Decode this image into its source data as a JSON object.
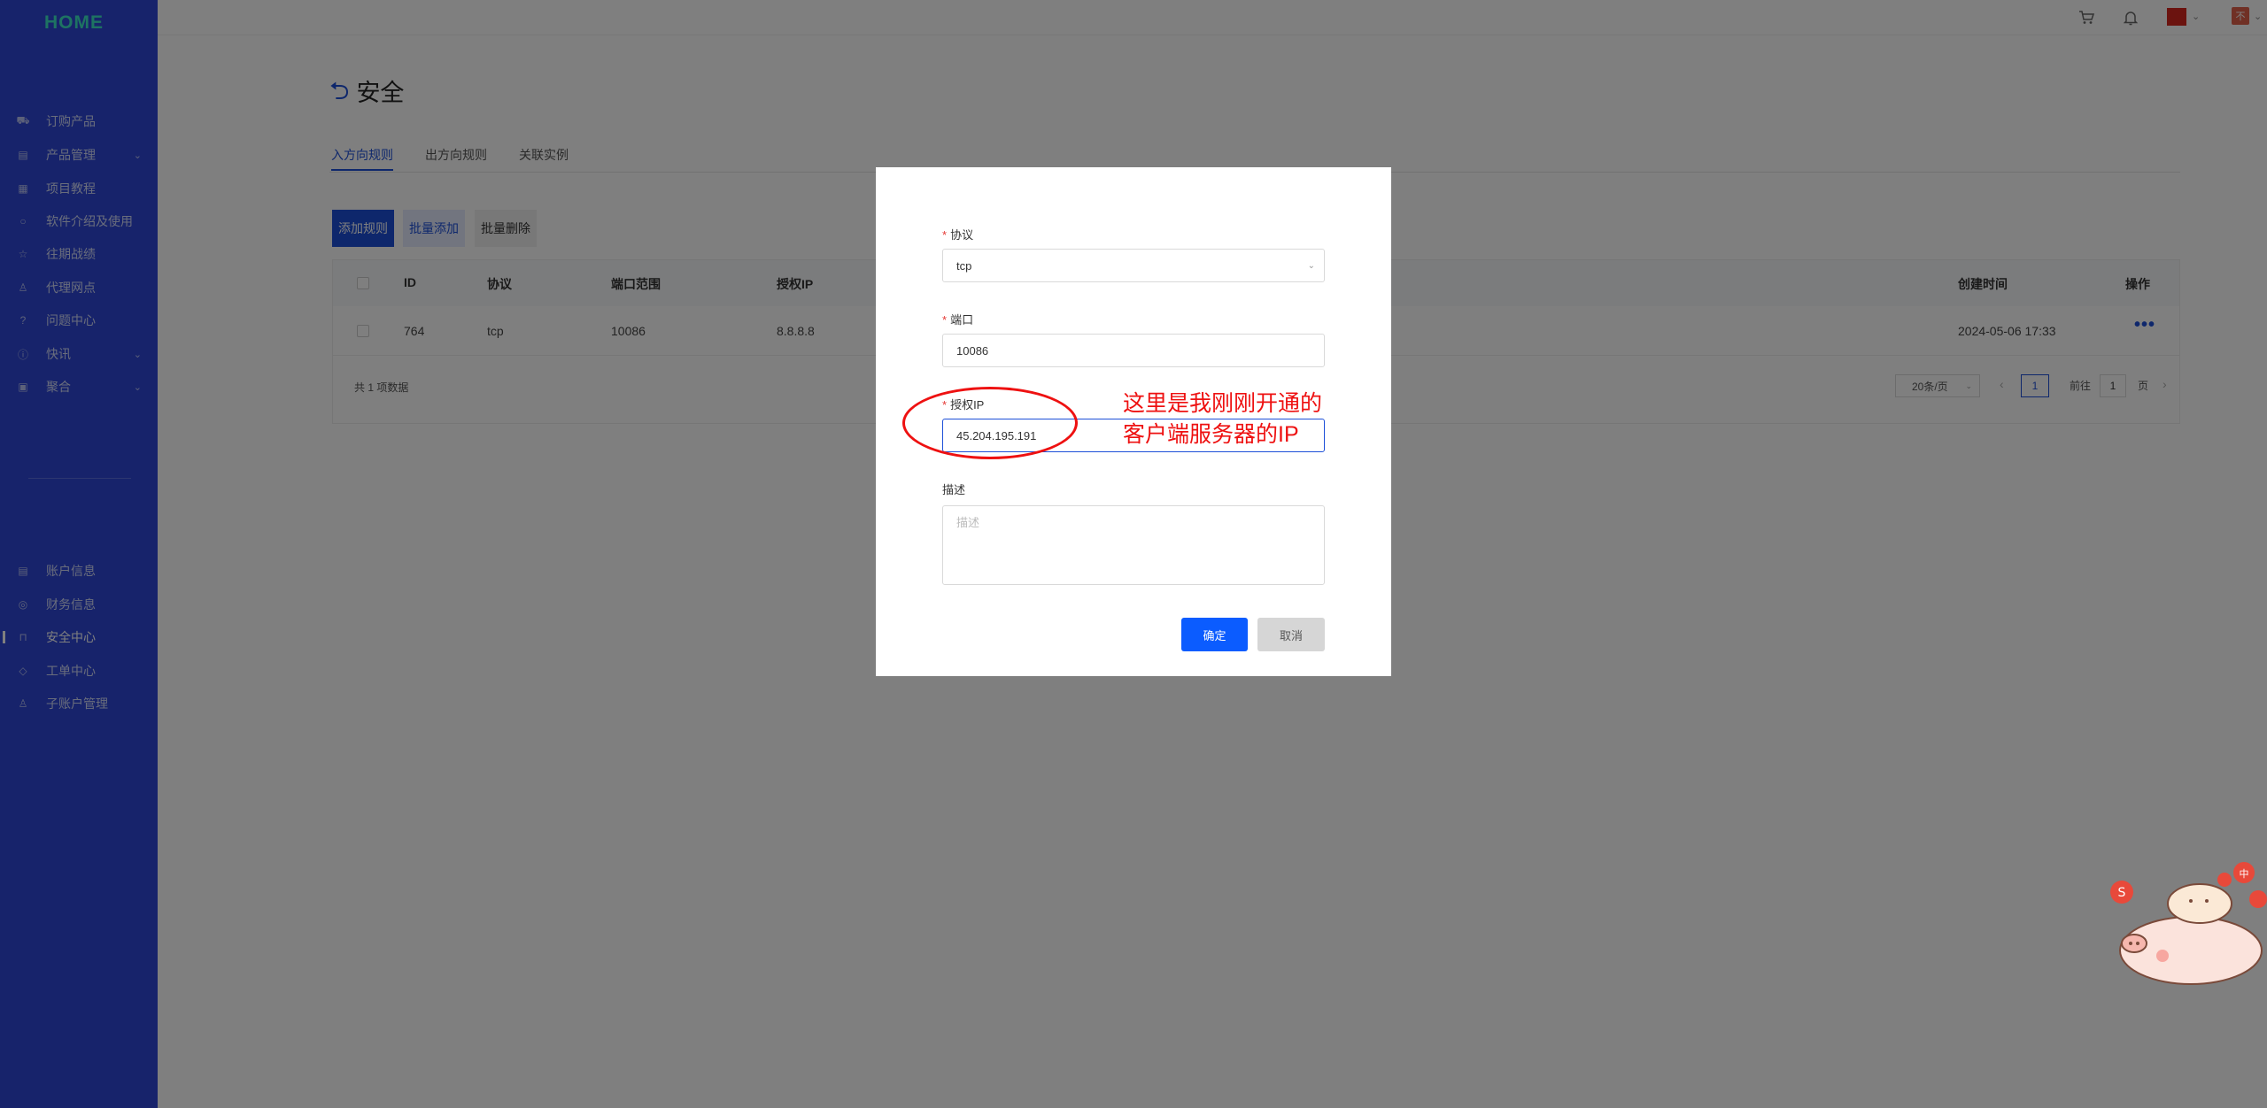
{
  "sidebar": {
    "logo": "HOME",
    "items": [
      {
        "label": "订购产品",
        "icon": "cart-icon",
        "has_chevron": false
      },
      {
        "label": "产品管理",
        "icon": "box-icon",
        "has_chevron": true
      },
      {
        "label": "项目教程",
        "icon": "book-icon",
        "has_chevron": false
      },
      {
        "label": "软件介绍及使用",
        "icon": "chat-icon",
        "has_chevron": false
      },
      {
        "label": "往期战绩",
        "icon": "star-icon",
        "has_chevron": false
      },
      {
        "label": "代理网点",
        "icon": "agent-icon",
        "has_chevron": false
      },
      {
        "label": "问题中心",
        "icon": "question-icon",
        "has_chevron": false
      },
      {
        "label": "快讯",
        "icon": "info-icon",
        "has_chevron": true
      },
      {
        "label": "聚合",
        "icon": "bookmark-icon",
        "has_chevron": true
      }
    ],
    "account_items": [
      {
        "label": "账户信息",
        "icon": "account-icon"
      },
      {
        "label": "财务信息",
        "icon": "finance-icon"
      },
      {
        "label": "安全中心",
        "icon": "lock-icon",
        "active": true
      },
      {
        "label": "工单中心",
        "icon": "ticket-icon"
      },
      {
        "label": "子账户管理",
        "icon": "user-icon"
      }
    ]
  },
  "topbar": {
    "avatar_text": "不"
  },
  "page": {
    "title": "安全",
    "tabs": [
      "入方向规则",
      "出方向规则",
      "关联实例"
    ],
    "buttons": {
      "add_rule": "添加规则",
      "batch_add": "批量添加",
      "batch_delete": "批量删除"
    },
    "table": {
      "columns": {
        "id": "ID",
        "protocol": "协议",
        "port_range": "端口范围",
        "auth_ip": "授权IP",
        "created": "创建时间",
        "action": "操作"
      },
      "rows": [
        {
          "id": "764",
          "protocol": "tcp",
          "port_range": "10086",
          "auth_ip": "8.8.8.8",
          "created": "2024-05-06 17:33",
          "action": "•••"
        }
      ],
      "total_text": "共 1 项数据",
      "page_size": "20条/页",
      "current_page": "1",
      "goto_label": "前往",
      "goto_value": "1",
      "page_suffix": "页"
    }
  },
  "modal": {
    "protocol_label": "协议",
    "protocol_value": "tcp",
    "port_label": "端口",
    "port_value": "10086",
    "ip_label": "授权IP",
    "ip_value": "45.204.195.191",
    "desc_label": "描述",
    "desc_placeholder": "描述",
    "ok": "确定",
    "cancel": "取消"
  },
  "annotation": {
    "line1": "这里是我刚刚开通的",
    "line2": "客户端服务器的IP",
    "color": "#ee1111"
  },
  "colors": {
    "sidebar": "#2f47d6",
    "primary": "#1d4fd8",
    "confirm_button": "#0b5cff"
  }
}
